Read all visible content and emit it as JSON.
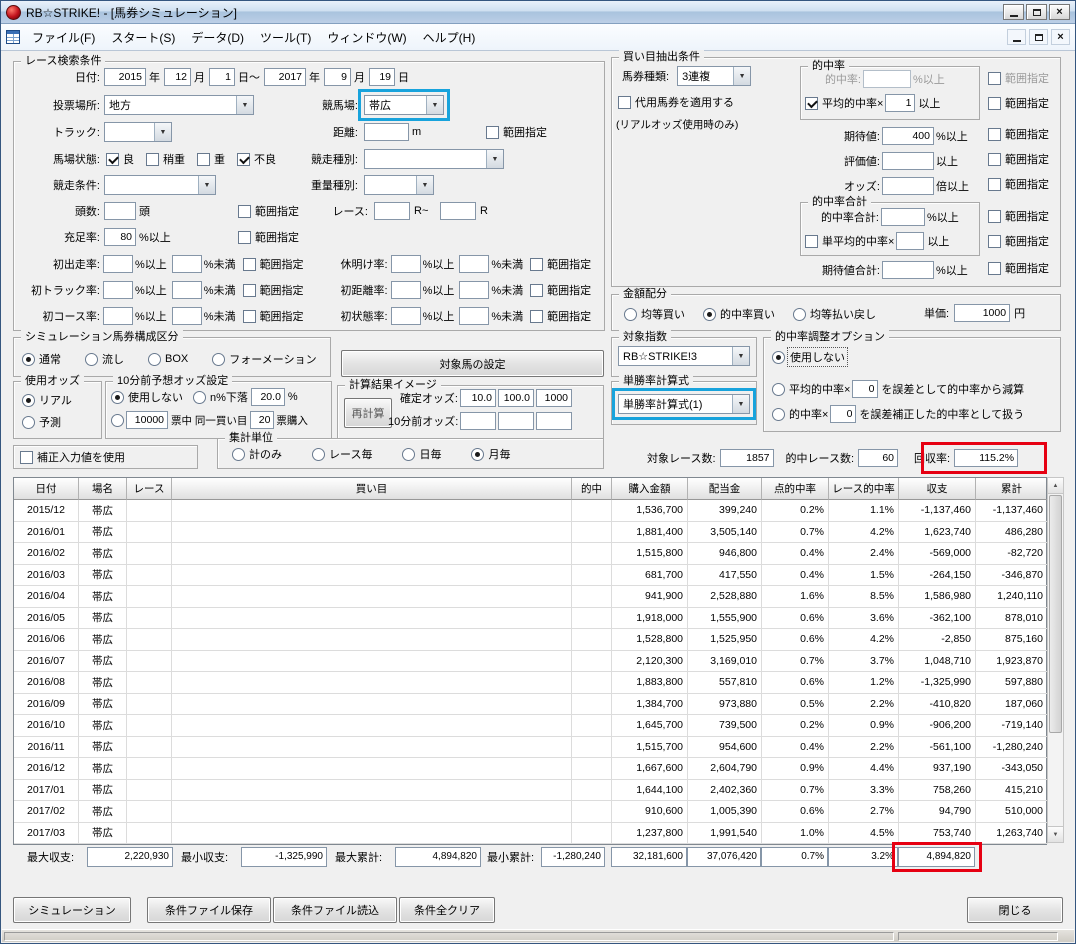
{
  "window": {
    "title": "RB☆STRIKE! - [馬券シミュレーション]",
    "menu_items": [
      "ファイル(F)",
      "スタート(S)",
      "データ(D)",
      "ツール(T)",
      "ウィンドウ(W)",
      "ヘルプ(H)"
    ]
  },
  "labels": {
    "range": "範囲指定",
    "pct_above": "%以上",
    "pct_below": "%未満",
    "above": "以上",
    "times_above": "倍以上",
    "year": "年",
    "month": "月",
    "day": "日",
    "day_to": "日～",
    "meter": "m",
    "heads": "頭",
    "r_to": "R~",
    "r": "R",
    "yen": "円",
    "pct": "%"
  },
  "annotations": {
    "blue": "#18a3dc",
    "red": "#e60012"
  },
  "search": {
    "title": "レース検索条件",
    "date_label": "日付:",
    "from_year": "2015",
    "from_month": "12",
    "from_day": "1",
    "to_year": "2017",
    "to_month": "9",
    "to_day": "19",
    "place_label": "投票場所:",
    "place_value": "地方",
    "course_label": "競馬場:",
    "course_value": "帯広",
    "track_label": "トラック:",
    "track_value": "",
    "distance_label": "距離:",
    "distance_value": "",
    "baba_label": "馬場状態:",
    "baba": [
      {
        "label": "良",
        "checked": true
      },
      {
        "label": "稍重",
        "checked": false
      },
      {
        "label": "重",
        "checked": false
      },
      {
        "label": "不良",
        "checked": true
      }
    ],
    "kind_label": "競走種別:",
    "kind_value": "",
    "cond_label": "競走条件:",
    "cond_value": "",
    "weight_label": "重量種別:",
    "weight_value": "",
    "heads_label": "頭数:",
    "heads_value": "",
    "race_label": "レース:",
    "race_from": "",
    "race_to": "",
    "fill_label": "充足率:",
    "fill_value": "80",
    "rate_rows": [
      {
        "left_label": "初出走率:",
        "right_label": "休明け率:",
        "values": [
          "",
          "",
          "",
          ""
        ]
      },
      {
        "left_label": "初トラック率:",
        "right_label": "初距離率:",
        "values": [
          "",
          "",
          "",
          ""
        ]
      },
      {
        "left_label": "初コース率:",
        "right_label": "初状態率:",
        "values": [
          "",
          "",
          "",
          ""
        ]
      }
    ]
  },
  "extract": {
    "title": "買い目抽出条件",
    "ticket_label": "馬券種類:",
    "ticket_value": "3連複",
    "substitute_label": "代用馬券を適用する",
    "substitute_note": "(リアルオッズ使用時のみ)",
    "hit_group_title": "的中率",
    "hit_label": "的中率:",
    "hit_value": "",
    "avg_hit_label": "平均的中率×",
    "avg_hit_value": "1",
    "expect_label": "期待値:",
    "expect_value": "400",
    "eval_label": "評価値:",
    "eval_value": "",
    "odds_label": "オッズ:",
    "odds_value": "",
    "hit_total_title": "的中率合計",
    "hit_total_label": "的中率合計:",
    "hit_total_value": "",
    "single_avg_label": "単平均的中率×",
    "single_avg_value": "",
    "expect_total_label": "期待値合計:",
    "expect_total_value": ""
  },
  "amount": {
    "title": "金額配分",
    "options": [
      "均等買い",
      "的中率買い",
      "均等払い戻し"
    ],
    "selected": 1,
    "unit_label": "単価:",
    "unit_value": "1000"
  },
  "composition": {
    "title": "シミュレーション馬券構成区分",
    "options": [
      "通常",
      "流し",
      "BOX",
      "フォーメーション"
    ],
    "selected": 0,
    "target_button": "対象馬の設定"
  },
  "odds_use": {
    "title": "使用オッズ",
    "options": [
      "リアル",
      "予測"
    ],
    "selected": 0
  },
  "pre_odds": {
    "title": "10分前予想オッズ設定",
    "not_use": "使用しない",
    "drop_label": "n%下落",
    "drop_value": "20.0",
    "votes_value": "10000",
    "votes_mid": "票中 同一買い目",
    "votes_count": "20",
    "votes_suffix": "票購入"
  },
  "calc_image": {
    "title": "計算結果イメージ",
    "recalc_button": "再計算",
    "fixed_label": "確定オッズ:",
    "fixed_values": [
      "10.0",
      "100.0",
      "1000"
    ],
    "pre_label": "10分前オッズ:",
    "pre_values": [
      "",
      "",
      ""
    ]
  },
  "correction": {
    "label": "補正入力値を使用",
    "checked": false
  },
  "agg_unit": {
    "title": "集計単位",
    "options": [
      "計のみ",
      "レース毎",
      "日毎",
      "月毎"
    ],
    "selected": 3
  },
  "target_index": {
    "title": "対象指数",
    "value": "RB☆STRIKE!3"
  },
  "win_formula": {
    "title": "単勝率計算式",
    "value": "単勝率計算式(1)"
  },
  "hit_adjust": {
    "title": "的中率調整オプション",
    "not_use": "使用しない",
    "opt2_pre": "平均的中率×",
    "opt2_value": "0",
    "opt2_post": "を誤差として的中率から減算",
    "opt3_pre": "的中率×",
    "opt3_value": "0",
    "opt3_post": "を誤差補正した的中率として扱う"
  },
  "stats": {
    "target_races_label": "対象レース数:",
    "target_races": "1857",
    "hit_races_label": "的中レース数:",
    "hit_races": "60",
    "recovery_label": "回収率:",
    "recovery": "115.2%"
  },
  "table": {
    "columns": [
      "日付",
      "場名",
      "レース",
      "買い目",
      "的中",
      "購入金額",
      "配当金",
      "点的中率",
      "レース的中率",
      "収支",
      "累計"
    ],
    "rows": [
      [
        "2015/12",
        "帯広",
        "",
        "",
        "",
        "1,536,700",
        "399,240",
        "0.2%",
        "1.1%",
        "-1,137,460",
        "-1,137,460"
      ],
      [
        "2016/01",
        "帯広",
        "",
        "",
        "",
        "1,881,400",
        "3,505,140",
        "0.7%",
        "4.2%",
        "1,623,740",
        "486,280"
      ],
      [
        "2016/02",
        "帯広",
        "",
        "",
        "",
        "1,515,800",
        "946,800",
        "0.4%",
        "2.4%",
        "-569,000",
        "-82,720"
      ],
      [
        "2016/03",
        "帯広",
        "",
        "",
        "",
        "681,700",
        "417,550",
        "0.4%",
        "1.5%",
        "-264,150",
        "-346,870"
      ],
      [
        "2016/04",
        "帯広",
        "",
        "",
        "",
        "941,900",
        "2,528,880",
        "1.6%",
        "8.5%",
        "1,586,980",
        "1,240,110"
      ],
      [
        "2016/05",
        "帯広",
        "",
        "",
        "",
        "1,918,000",
        "1,555,900",
        "0.6%",
        "3.6%",
        "-362,100",
        "878,010"
      ],
      [
        "2016/06",
        "帯広",
        "",
        "",
        "",
        "1,528,800",
        "1,525,950",
        "0.6%",
        "4.2%",
        "-2,850",
        "875,160"
      ],
      [
        "2016/07",
        "帯広",
        "",
        "",
        "",
        "2,120,300",
        "3,169,010",
        "0.7%",
        "3.7%",
        "1,048,710",
        "1,923,870"
      ],
      [
        "2016/08",
        "帯広",
        "",
        "",
        "",
        "1,883,800",
        "557,810",
        "0.6%",
        "1.2%",
        "-1,325,990",
        "597,880"
      ],
      [
        "2016/09",
        "帯広",
        "",
        "",
        "",
        "1,384,700",
        "973,880",
        "0.5%",
        "2.2%",
        "-410,820",
        "187,060"
      ],
      [
        "2016/10",
        "帯広",
        "",
        "",
        "",
        "1,645,700",
        "739,500",
        "0.2%",
        "0.9%",
        "-906,200",
        "-719,140"
      ],
      [
        "2016/11",
        "帯広",
        "",
        "",
        "",
        "1,515,700",
        "954,600",
        "0.4%",
        "2.2%",
        "-561,100",
        "-1,280,240"
      ],
      [
        "2016/12",
        "帯広",
        "",
        "",
        "",
        "1,667,600",
        "2,604,790",
        "0.9%",
        "4.4%",
        "937,190",
        "-343,050"
      ],
      [
        "2017/01",
        "帯広",
        "",
        "",
        "",
        "1,644,100",
        "2,402,360",
        "0.7%",
        "3.3%",
        "758,260",
        "415,210"
      ],
      [
        "2017/02",
        "帯広",
        "",
        "",
        "",
        "910,600",
        "1,005,390",
        "0.6%",
        "2.7%",
        "94,790",
        "510,000"
      ],
      [
        "2017/03",
        "帯広",
        "",
        "",
        "",
        "1,237,800",
        "1,991,540",
        "1.0%",
        "4.5%",
        "753,740",
        "1,263,740"
      ]
    ]
  },
  "summary": {
    "max_balance_label": "最大収支:",
    "max_balance": "2,220,930",
    "min_balance_label": "最小収支:",
    "min_balance": "-1,325,990",
    "max_total_label": "最大累計:",
    "max_total": "4,894,820",
    "min_total_label": "最小累計:",
    "min_total": "-1,280,240",
    "purchase_total": "32,181,600",
    "payout_total": "37,076,420",
    "point_hit_total": "0.7%",
    "race_hit_total": "3.2%",
    "balance_total": "4,894,820"
  },
  "buttons": {
    "simulate": "シミュレーション",
    "save": "条件ファイル保存",
    "load": "条件ファイル読込",
    "clear": "条件全クリア",
    "close": "閉じる"
  }
}
